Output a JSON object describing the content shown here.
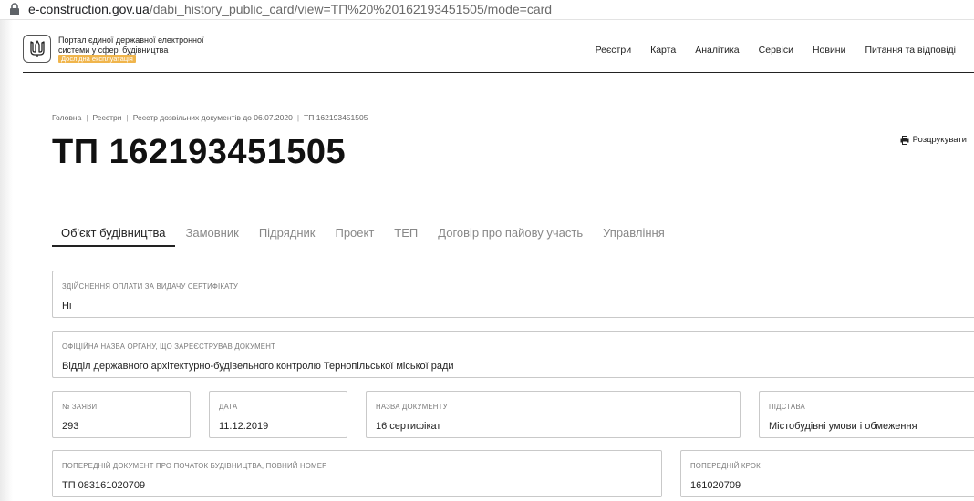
{
  "browser": {
    "url_domain": "e-construction.gov.ua",
    "url_path": "/dabi_history_public_card/view=ТП%20%20162193451505/mode=card"
  },
  "header": {
    "portal_name": "Портал єдиної державної електронної системи у сфері будівництва",
    "badge": "Дослідна експлуатація",
    "nav": [
      "Реєстри",
      "Карта",
      "Аналітика",
      "Сервіси",
      "Новини",
      "Питання та відповіді"
    ]
  },
  "breadcrumb": [
    "Головна",
    "Реєстри",
    "Реєстр дозвільних документів до 06.07.2020",
    "ТП 162193451505"
  ],
  "title": "ТП 162193451505",
  "print_label": "Роздрукувати",
  "tabs": [
    "Об'єкт будівництва",
    "Замовник",
    "Підрядник",
    "Проект",
    "ТЕП",
    "Договір про пайову участь",
    "Управління"
  ],
  "active_tab": 0,
  "fields": {
    "payment": {
      "label": "Здійснення оплати за видачу сертифікату",
      "value": "Ні"
    },
    "authority": {
      "label": "Офіційна назва органу, що зареєстрував документ",
      "value": "Відділ державного архітектурно-будівельного контролю Тернопільської міської ради"
    },
    "application_no": {
      "label": "№ заяви",
      "value": "293"
    },
    "date": {
      "label": "Дата",
      "value": "11.12.2019"
    },
    "doc_name": {
      "label": "Назва документу",
      "value": "16 сертифікат"
    },
    "basis": {
      "label": "Підстава",
      "value": "Містобудівні умови і обмеження"
    },
    "prev_doc": {
      "label": "Попередній документ про початок будівництва, повний номер",
      "value": "ТП 083161020709"
    },
    "prev_step": {
      "label": "Попередній крок",
      "value": "161020709"
    }
  }
}
